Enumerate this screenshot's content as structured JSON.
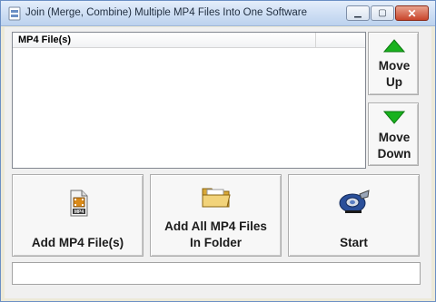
{
  "window": {
    "title": "Join (Merge, Combine) Multiple MP4 Files Into One Software",
    "minimize_glyph": "▁",
    "maximize_glyph": "▢",
    "close_glyph": "✕"
  },
  "file_list": {
    "column_header": "MP4 File(s)",
    "items": []
  },
  "side_buttons": {
    "move_up": {
      "line1": "Move",
      "line2": "Up",
      "icon": "arrow-up-icon"
    },
    "move_down": {
      "line1": "Move",
      "line2": "Down",
      "icon": "arrow-down-icon"
    }
  },
  "action_buttons": {
    "add_files": {
      "label": "Add MP4 File(s)",
      "icon": "mp4-file-icon"
    },
    "add_folder": {
      "line1": "Add All MP4 Files",
      "line2": "In Folder",
      "icon": "folder-icon"
    },
    "start": {
      "label": "Start",
      "icon": "tape-dispenser-icon"
    }
  },
  "status": {
    "text": ""
  },
  "colors": {
    "arrow_green": "#19b21e",
    "folder_yellow": "#e8c15a",
    "tape_blue": "#2a4f9a"
  }
}
